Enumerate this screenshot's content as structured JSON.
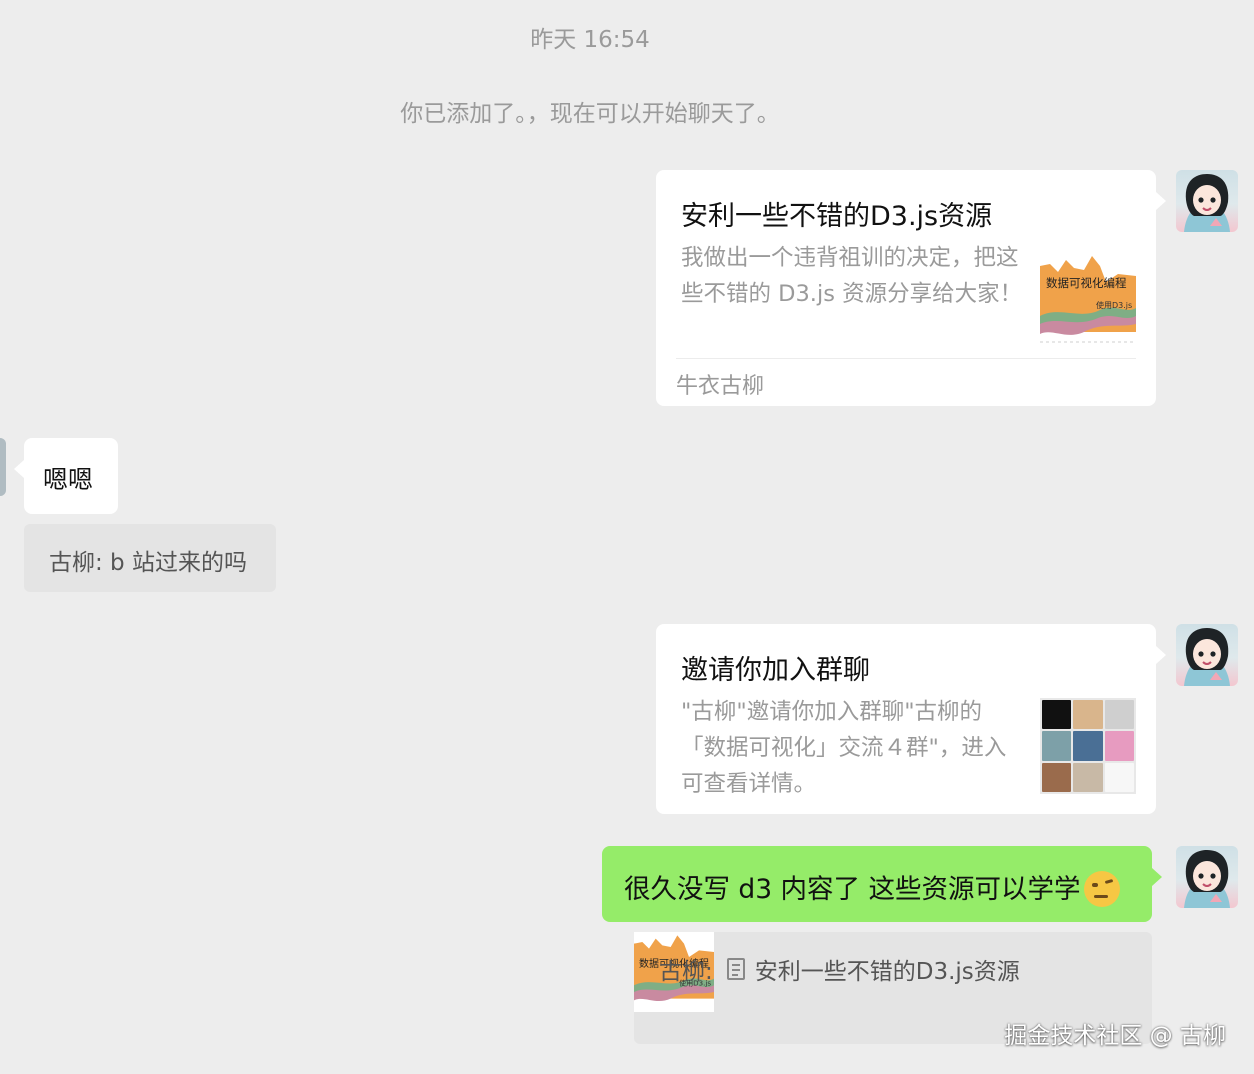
{
  "timestamp": "昨天 16:54",
  "system_notice": "你已添加了。，现在可以开始聊天了。",
  "link_card": {
    "title": "安利一些不错的D3.js资源",
    "description": "我做出一个违背祖训的决定，把这些不错的 D3.js 资源分享给大家！",
    "source": "牛衣古柳",
    "thumb_title": "数据可视化编程",
    "thumb_subtitle": "使用D3.js"
  },
  "incoming_message": {
    "text": "嗯嗯",
    "quote": "古柳: b 站过来的吗"
  },
  "invite_card": {
    "title": "邀请你加入群聊",
    "description": "\"古柳\"邀请你加入群聊\"古柳的「数据可视化」交流４群\"，进入可查看详情。"
  },
  "outgoing_message": {
    "text": "很久没写 d3 内容了 这些资源可以学学",
    "emoji": "🤨"
  },
  "quoted_link": {
    "prefix": "古柳:",
    "title": "安利一些不错的D3.js资源",
    "thumb_title": "数据可视化编程",
    "thumb_subtitle": "使用D3.js"
  },
  "watermark": "掘金技术社区 @ 古柳",
  "colors": {
    "background": "#ededed",
    "outgoing_bubble": "#95ec69",
    "card": "#ffffff",
    "quote_bg": "#e4e4e4",
    "muted_text": "#9a9a9a"
  }
}
